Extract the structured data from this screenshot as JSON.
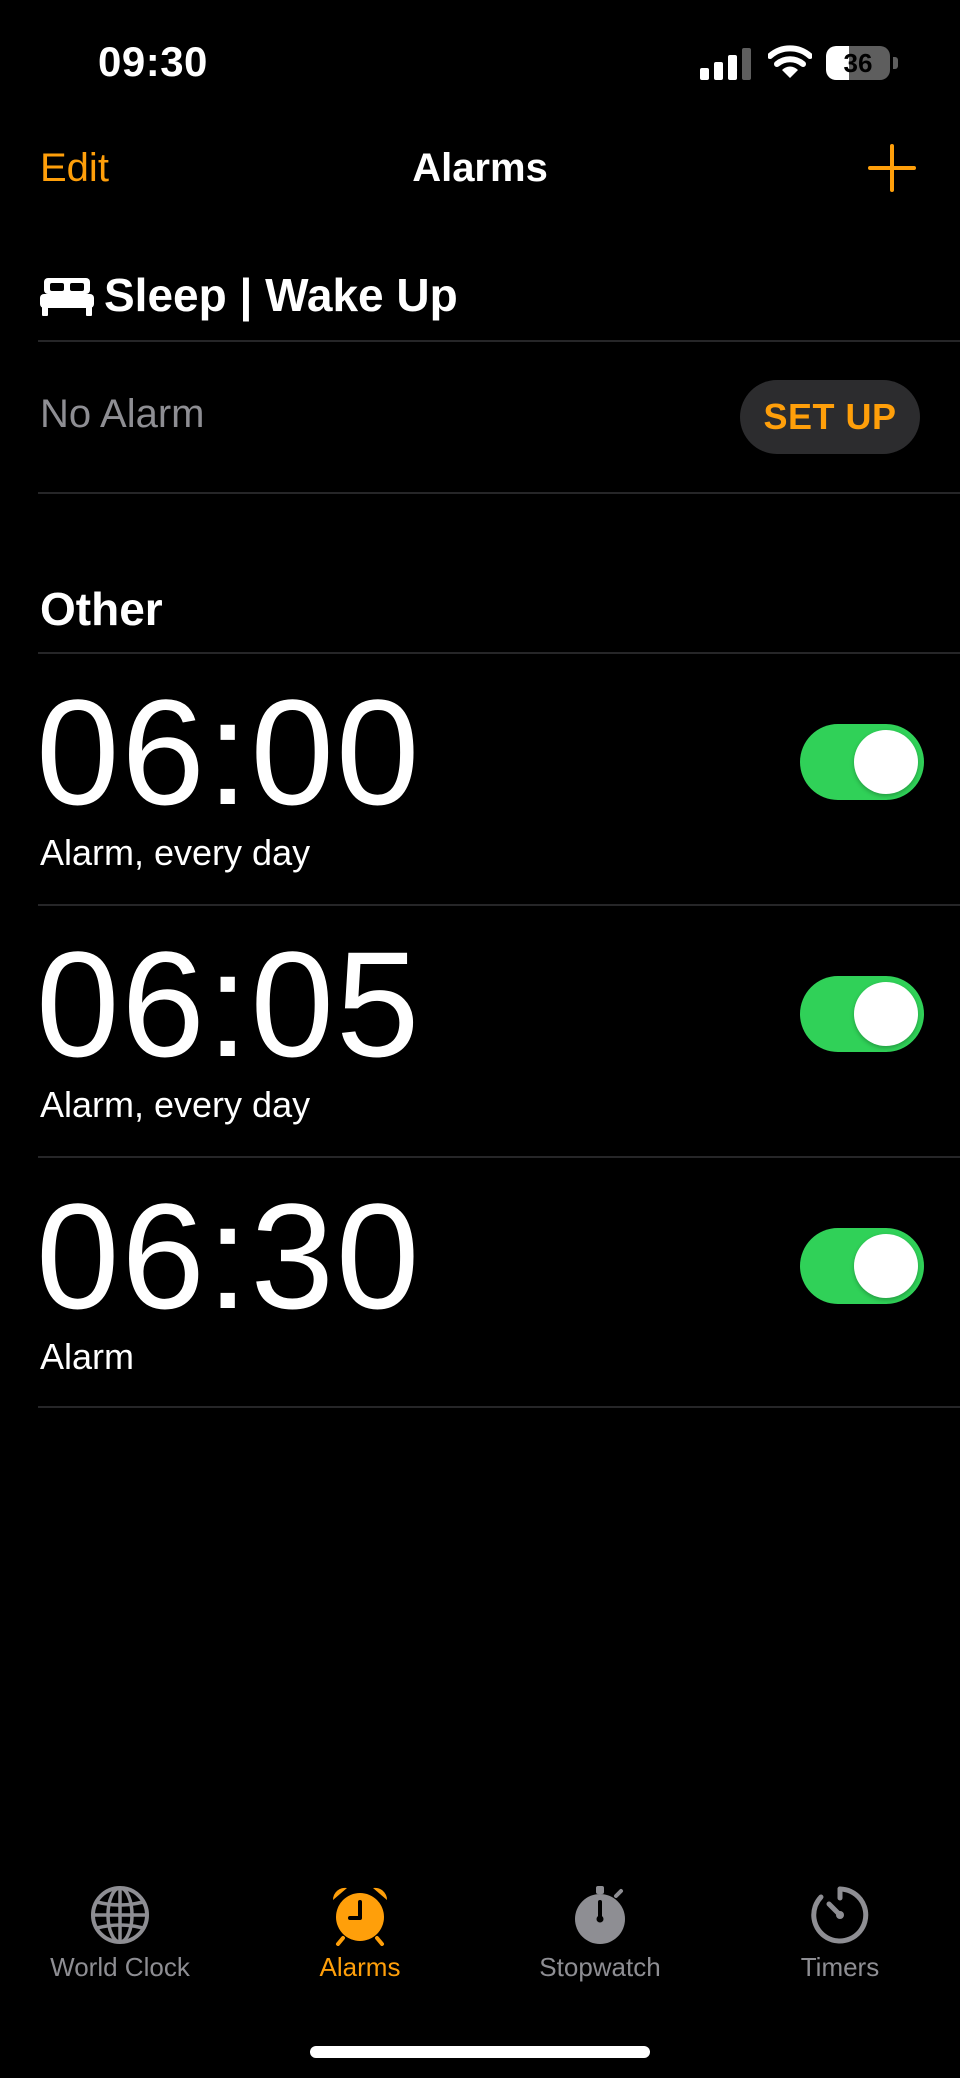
{
  "status_bar": {
    "time": "09:30",
    "battery_level": "36"
  },
  "nav": {
    "edit_label": "Edit",
    "title": "Alarms"
  },
  "sleep": {
    "title": "Sleep | Wake Up",
    "status": "No Alarm",
    "setup_label": "SET UP"
  },
  "other": {
    "title": "Other",
    "alarms": [
      {
        "time": "06:00",
        "label": "Alarm, every day",
        "enabled": true
      },
      {
        "time": "06:05",
        "label": "Alarm, every day",
        "enabled": true
      },
      {
        "time": "06:30",
        "label": "Alarm",
        "enabled": true
      }
    ]
  },
  "tabs": [
    {
      "label": "World Clock",
      "icon": "globe-icon",
      "active": false
    },
    {
      "label": "Alarms",
      "icon": "alarm-clock-icon",
      "active": true
    },
    {
      "label": "Stopwatch",
      "icon": "stopwatch-icon",
      "active": false
    },
    {
      "label": "Timers",
      "icon": "timer-icon",
      "active": false
    }
  ],
  "colors": {
    "accent": "#ff9f0a",
    "toggle_on": "#30d158",
    "secondary_text": "#8e8e93",
    "background": "#000000"
  }
}
